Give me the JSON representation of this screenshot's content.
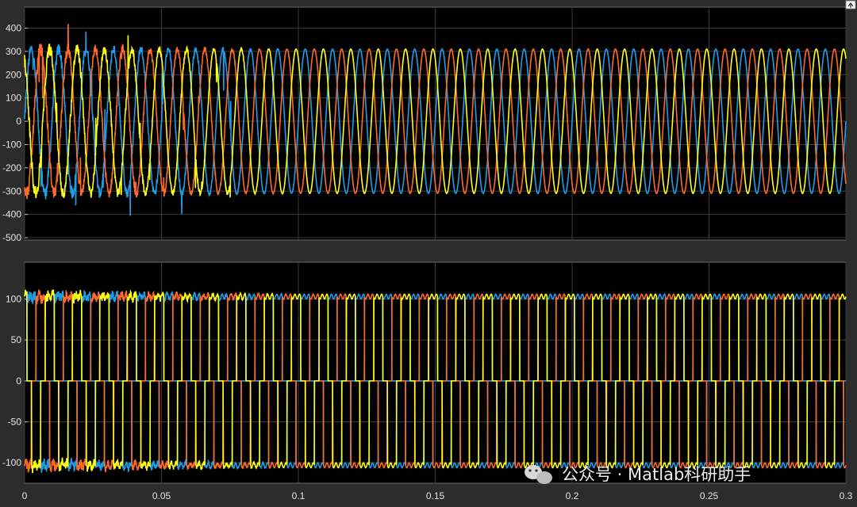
{
  "chart_data": [
    {
      "type": "line",
      "title": "",
      "xlabel": "",
      "ylabel": "",
      "xlim": [
        0,
        0.3
      ],
      "ylim": [
        -510,
        490
      ],
      "yticks": [
        -500,
        -400,
        -300,
        -200,
        -100,
        0,
        100,
        200,
        300,
        400
      ],
      "xticks": [
        0,
        0.05,
        0.1,
        0.15,
        0.2,
        0.25,
        0.3
      ],
      "grid": true,
      "background": "#000000",
      "waveform": {
        "shape": "sine",
        "frequency_hz": 100,
        "amplitude": 310,
        "transient_until_s": 0.1,
        "transient_peak": 400
      },
      "series": [
        {
          "color": "#1e9ee8",
          "phase_deg": 0
        },
        {
          "color": "#ff6a2a",
          "phase_deg": -120
        },
        {
          "color": "#ffff1a",
          "phase_deg": 120
        }
      ]
    },
    {
      "type": "line",
      "title": "",
      "xlabel": "",
      "ylabel": "",
      "xlim": [
        0,
        0.3
      ],
      "ylim": [
        -125,
        145
      ],
      "yticks": [
        -100,
        -50,
        0,
        50,
        100
      ],
      "xticks": [
        0,
        0.05,
        0.1,
        0.15,
        0.2,
        0.25,
        0.3
      ],
      "xticklabels": [
        "0",
        "0.05",
        "0.1",
        "0.15",
        "0.2",
        "0.25",
        "0.3"
      ],
      "grid": true,
      "background": "#000000",
      "waveform": {
        "shape": "square-with-dead-zone",
        "frequency_hz": 100,
        "amplitude": 103,
        "transient_until_s": 0.1
      },
      "series": [
        {
          "color": "#1e9ee8",
          "phase_deg": 0
        },
        {
          "color": "#ff6a2a",
          "phase_deg": -120
        },
        {
          "color": "#ffff1a",
          "phase_deg": 120
        }
      ]
    }
  ],
  "watermark": {
    "text": "公众号 · Matlab科研助手",
    "icon": "wechat-icon"
  },
  "toolbar": {
    "icon": "expand-icon"
  }
}
